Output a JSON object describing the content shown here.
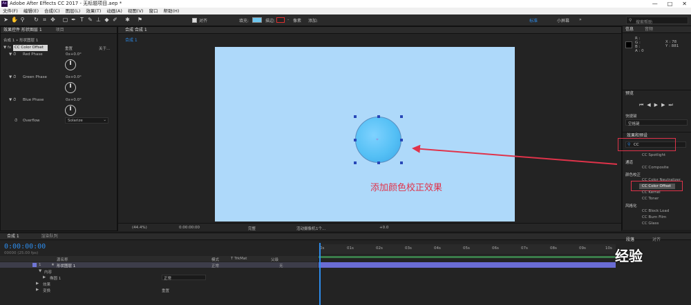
{
  "window": {
    "title": "Adobe After Effects CC 2017 - 无标题项目.aep *",
    "app_icon": "Ae",
    "controls": [
      "—",
      "□",
      "✕"
    ]
  },
  "menu": [
    "文件(F)",
    "编辑(E)",
    "合成(C)",
    "图层(L)",
    "效果(T)",
    "动画(A)",
    "视图(V)",
    "窗口",
    "帮助(H)"
  ],
  "toolbar": {
    "align_label": "对齐",
    "fill_label": "填充:",
    "stroke_label": "描边:",
    "stroke_value": "-",
    "stroke_unit": "像素",
    "add_label": "添加:",
    "workspaces": [
      "标准",
      "小屏幕"
    ],
    "search_placeholder": "搜索帮助",
    "fill_color": "#6ec7ef",
    "stroke_color": "#e03030"
  },
  "effects_panel": {
    "tab_label": "效果控件 形状图层 1",
    "project_tab": "项目",
    "breadcrumb": "合成 1 • 形状图层 1",
    "effect_name": "CC Color Offset",
    "reset": "重置",
    "about": "关于...",
    "properties": [
      {
        "name": "Red Phase",
        "value": "0x+0.0°"
      },
      {
        "name": "Green Phase",
        "value": "0x+0.0°"
      },
      {
        "name": "Blue Phase",
        "value": "0x+0.0°"
      }
    ],
    "overflow_label": "Overflow",
    "overflow_value": "Solarize"
  },
  "comp_panel": {
    "tab_label": "合成 合成 1",
    "sub_tab": "合成 1",
    "zoom": "(44.4%)",
    "timecode": "0:00:00:00",
    "resolution": "完整",
    "camera": "活动摄像机",
    "views": "1个...",
    "exposure": "+0.0"
  },
  "annotation": {
    "text": "添加颜色校正效果"
  },
  "right_panels": {
    "info_tab": "信息",
    "audio_tab": "音频",
    "info_rgb": [
      "R :",
      "G :",
      "B :",
      "A : 0"
    ],
    "info_xy": [
      "X : 78",
      "Y : 881"
    ],
    "preview_tab": "预览",
    "shortcut_label": "快捷键",
    "shortcut_value": "空格键",
    "effects_tab": "效果和预设",
    "search_value": "CC",
    "effects_list": [
      {
        "type": "item",
        "label": "CC Spotlight"
      },
      {
        "type": "category",
        "label": "通道"
      },
      {
        "type": "item",
        "label": "CC Composite"
      },
      {
        "type": "category",
        "label": "颜色校正"
      },
      {
        "type": "item",
        "label": "CC Color Neutralizer"
      },
      {
        "type": "item",
        "label": "CC Color Offset"
      },
      {
        "type": "item",
        "label": "CC Kernel"
      },
      {
        "type": "item",
        "label": "CC Toner"
      },
      {
        "type": "category",
        "label": "风格化"
      },
      {
        "type": "item",
        "label": "CC Block Load"
      },
      {
        "type": "item",
        "label": "CC Burn Film"
      },
      {
        "type": "item",
        "label": "CC Glass"
      }
    ],
    "paragraph_tab": "段落",
    "align_tab": "对齐"
  },
  "timeline": {
    "tab_label": "合成 1",
    "render_tab": "渲染队列",
    "timecode": "0:00:00:00",
    "fps": "00000 (25.00 fps)",
    "columns": [
      "源名称",
      "模式",
      "T TrkMat",
      "父级"
    ],
    "layer": {
      "num": "1",
      "name": "形状图层 1",
      "mode": "正常",
      "parent": "无"
    },
    "subrows": [
      {
        "label": "内容",
        "value": ""
      },
      {
        "label": "椭圆 1",
        "value": "正常"
      },
      {
        "label": "效果",
        "value": ""
      },
      {
        "label": "变换",
        "value": "重置"
      }
    ],
    "ruler": [
      "0s",
      "01s",
      "02s",
      "03s",
      "04s",
      "05s",
      "06s",
      "07s",
      "08s",
      "09s",
      "10s"
    ],
    "watermark": "经验"
  }
}
